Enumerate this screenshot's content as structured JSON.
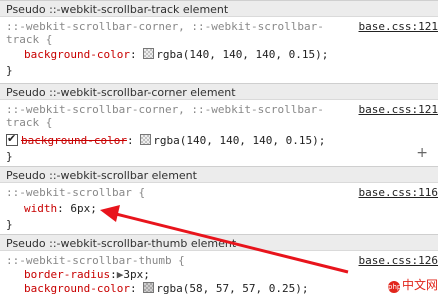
{
  "sections": [
    {
      "header": "Pseudo ::-webkit-scrollbar-track element",
      "selector_line1": "::-webkit-scrollbar-corner, ::-webkit-scrollbar-",
      "selector_line2": "track {",
      "source": "base.css:121",
      "prop": "background-color",
      "value": "rgba(140, 140, 140, 0.15);",
      "swatch": "#8c8c8c26",
      "close": "}"
    },
    {
      "header": "Pseudo ::-webkit-scrollbar-corner element",
      "selector_line1": "::-webkit-scrollbar-corner, ::-webkit-scrollbar-",
      "selector_line2": "track {",
      "source": "base.css:121",
      "prop": "background-color",
      "value": "rgba(140, 140, 140, 0.15);",
      "swatch": "#8c8c8c26",
      "close": "}",
      "plus": "+"
    },
    {
      "header": "Pseudo ::-webkit-scrollbar element",
      "selector_line1": "::-webkit-scrollbar {",
      "source": "base.css:116",
      "prop": "width",
      "value": "6px;",
      "close": "}"
    },
    {
      "header": "Pseudo ::-webkit-scrollbar-thumb element",
      "selector_line1": "::-webkit-scrollbar-thumb {",
      "source": "base.css:126",
      "prop1": "border-radius",
      "value1": "3px;",
      "prop2": "background-color",
      "value2": "rgba(58, 57, 57, 0.25);",
      "swatch": "#3a393940"
    }
  ],
  "logo": {
    "text": "中文网",
    "mark": "php"
  },
  "colors": {
    "arrow": "#e8141c",
    "property": "#c80000"
  }
}
